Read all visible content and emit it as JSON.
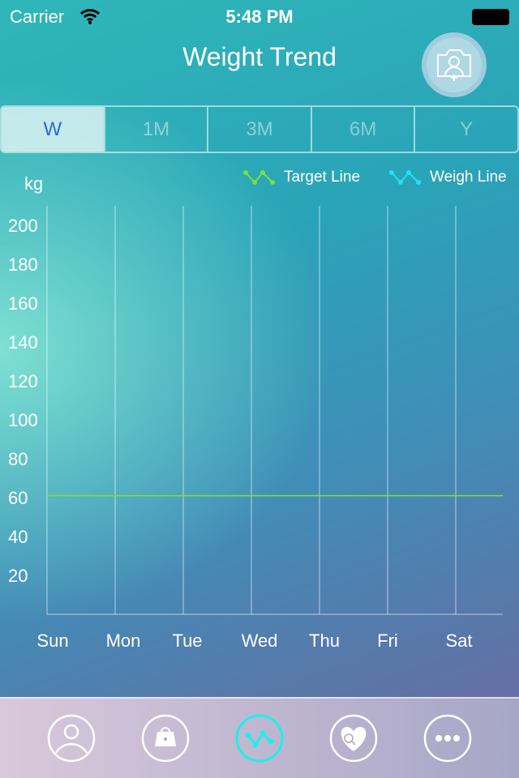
{
  "status": {
    "carrier": "Carrier",
    "time": "5:48 PM"
  },
  "header": {
    "title": "Weight Trend",
    "camera_icon": "camera-add-person-icon"
  },
  "segments": [
    {
      "label": "W",
      "selected": true
    },
    {
      "label": "1M"
    },
    {
      "label": "3M"
    },
    {
      "label": "6M"
    },
    {
      "label": "Y"
    }
  ],
  "colors": {
    "target": "#7de03a",
    "weigh": "#19e6f0",
    "selected_tab": "#2a6ad8",
    "active_icon": "#19f0f0"
  },
  "chart_data": {
    "type": "line",
    "ylabel": "kg",
    "categories": [
      "Sun",
      "Mon",
      "Tue",
      "Wed",
      "Thu",
      "Fri",
      "Sat"
    ],
    "yticks": [
      "200",
      "180",
      "160",
      "140",
      "120",
      "100",
      "80",
      "60",
      "40",
      "20"
    ],
    "ylim": [
      0,
      210
    ],
    "legend": [
      "Target Line",
      "Weigh Line"
    ],
    "legend_placement": "top-right",
    "series": [
      {
        "name": "Target Line",
        "values": [
          61,
          61,
          61,
          61,
          61,
          61,
          61
        ]
      },
      {
        "name": "Weigh Line",
        "values": []
      }
    ]
  },
  "tabs": [
    {
      "icon": "profile-icon"
    },
    {
      "icon": "scale-icon"
    },
    {
      "icon": "trend-icon",
      "active": true
    },
    {
      "icon": "heart-search-icon"
    },
    {
      "icon": "more-icon"
    }
  ]
}
